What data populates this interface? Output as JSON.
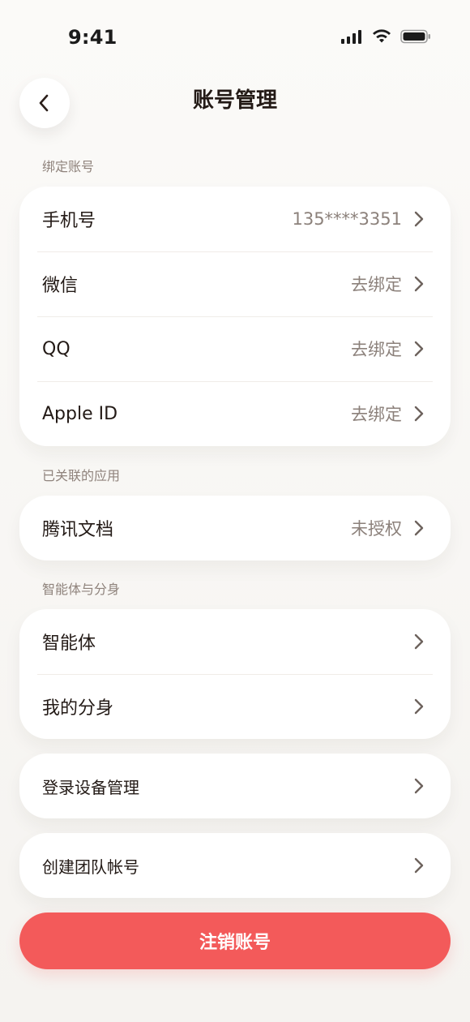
{
  "status_bar": {
    "time": "9:41",
    "icons": [
      "cellular-signal-icon",
      "wifi-icon",
      "battery-icon"
    ]
  },
  "header": {
    "title": "账号管理",
    "back_icon": "chevron-left-icon"
  },
  "sections": {
    "bound_accounts": {
      "label": "绑定账号",
      "items": [
        {
          "title": "手机号",
          "value": "135****3351"
        },
        {
          "title": "微信",
          "value": "去绑定"
        },
        {
          "title": "QQ",
          "value": "去绑定"
        },
        {
          "title": "Apple ID",
          "value": "去绑定"
        }
      ]
    },
    "linked_apps": {
      "label": "已关联的应用",
      "items": [
        {
          "title": "腾讯文档",
          "value": "未授权"
        }
      ]
    },
    "agents": {
      "label": "智能体与分身",
      "items": [
        {
          "title": "智能体"
        },
        {
          "title": "我的分身"
        }
      ]
    }
  },
  "standalone_rows": [
    {
      "title": "登录设备管理"
    },
    {
      "title": "创建团队帐号"
    }
  ],
  "danger_button": {
    "label": "注销账号"
  },
  "colors": {
    "background": "#f7f5f2",
    "card": "#ffffff",
    "text_primary": "#231a16",
    "text_secondary": "#8c817b",
    "section_label": "#8f837c",
    "divider": "#f0ece8",
    "danger": "#f35a5a"
  }
}
